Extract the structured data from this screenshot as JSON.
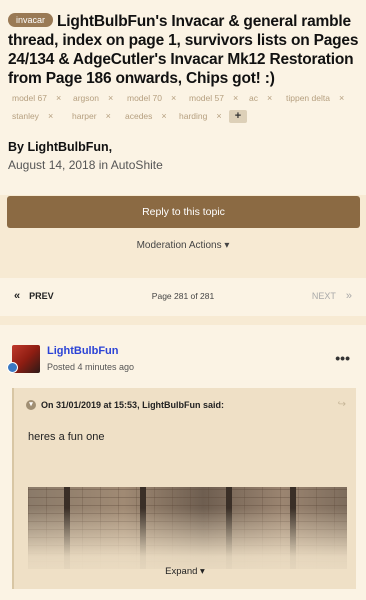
{
  "topic": {
    "prefix": "invacar",
    "title": "LightBulbFun's Invacar & general ramble thread, index on page 1, survivors lists on Pages 24/134 & AdgeCutler's Invacar Mk12 Restoration from Page 186 onwards, Chips got! :)",
    "tags_row1": [
      "model 67",
      "argson",
      "model 70",
      "model 57",
      "ac",
      "tippen delta"
    ],
    "tags_row2": [
      "stanley",
      "harper",
      "acedes",
      "harding"
    ],
    "tag_remove_glyph": "×",
    "tag_more_glyph": "+",
    "author_line": "By LightBulbFun,",
    "date_line": "August 14, 2018 in AutoShite"
  },
  "actions": {
    "reply_label": "Reply to this topic",
    "moderation_label": "Moderation Actions",
    "moderation_caret": "▾"
  },
  "pagination": {
    "prev_label": "PREV",
    "prev_glyph": "«",
    "page_info": "Page 281 of 281",
    "next_label": "NEXT",
    "next_glyph": "»"
  },
  "post": {
    "author": "LightBulbFun",
    "posted": "Posted 4 minutes ago",
    "menu_glyph": "•••",
    "quote_citation": "On 31/01/2019 at 15:53, LightBulbFun said:",
    "quote_text": "heres a fun one",
    "expand_label": "Expand",
    "expand_caret": "▾",
    "share_glyph": "↪"
  },
  "colors": {
    "accent": "#8b6a43",
    "page_bg": "#f7ead3",
    "card_bg": "#fbf3e4",
    "quote_bg": "#efe0c6",
    "username": "#2b43d6"
  },
  "icons": [
    "chevron-circle-icon",
    "share-icon",
    "ellipsis-icon",
    "rank-badge-icon",
    "caret-down-icon"
  ]
}
